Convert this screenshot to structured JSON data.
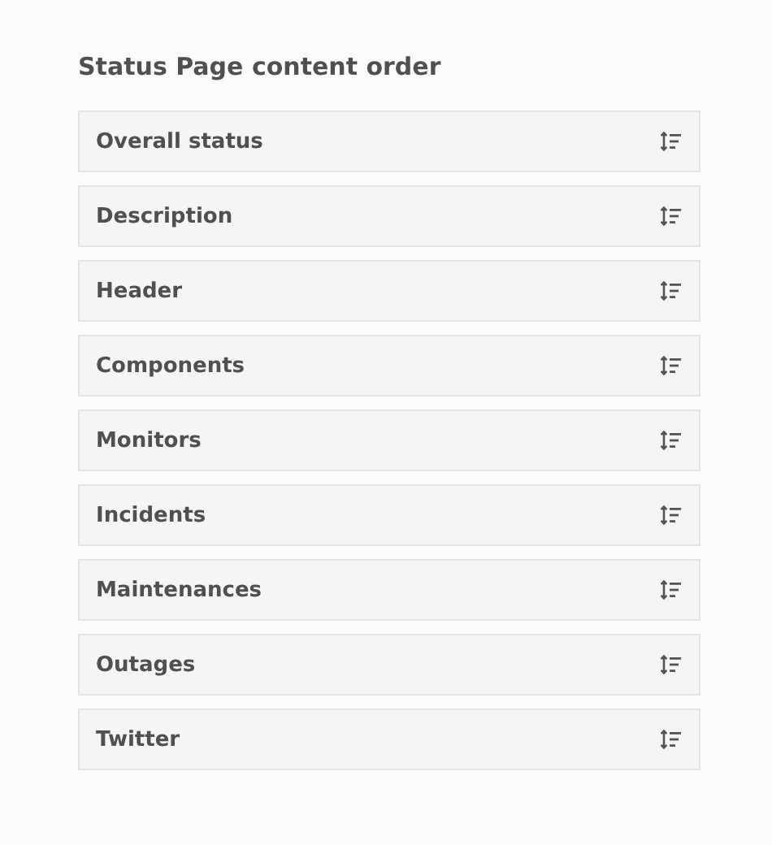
{
  "title": "Status Page content order",
  "items": [
    {
      "label": "Overall status"
    },
    {
      "label": "Description"
    },
    {
      "label": "Header"
    },
    {
      "label": "Components"
    },
    {
      "label": "Monitors"
    },
    {
      "label": "Incidents"
    },
    {
      "label": "Maintenances"
    },
    {
      "label": "Outages"
    },
    {
      "label": "Twitter"
    }
  ]
}
